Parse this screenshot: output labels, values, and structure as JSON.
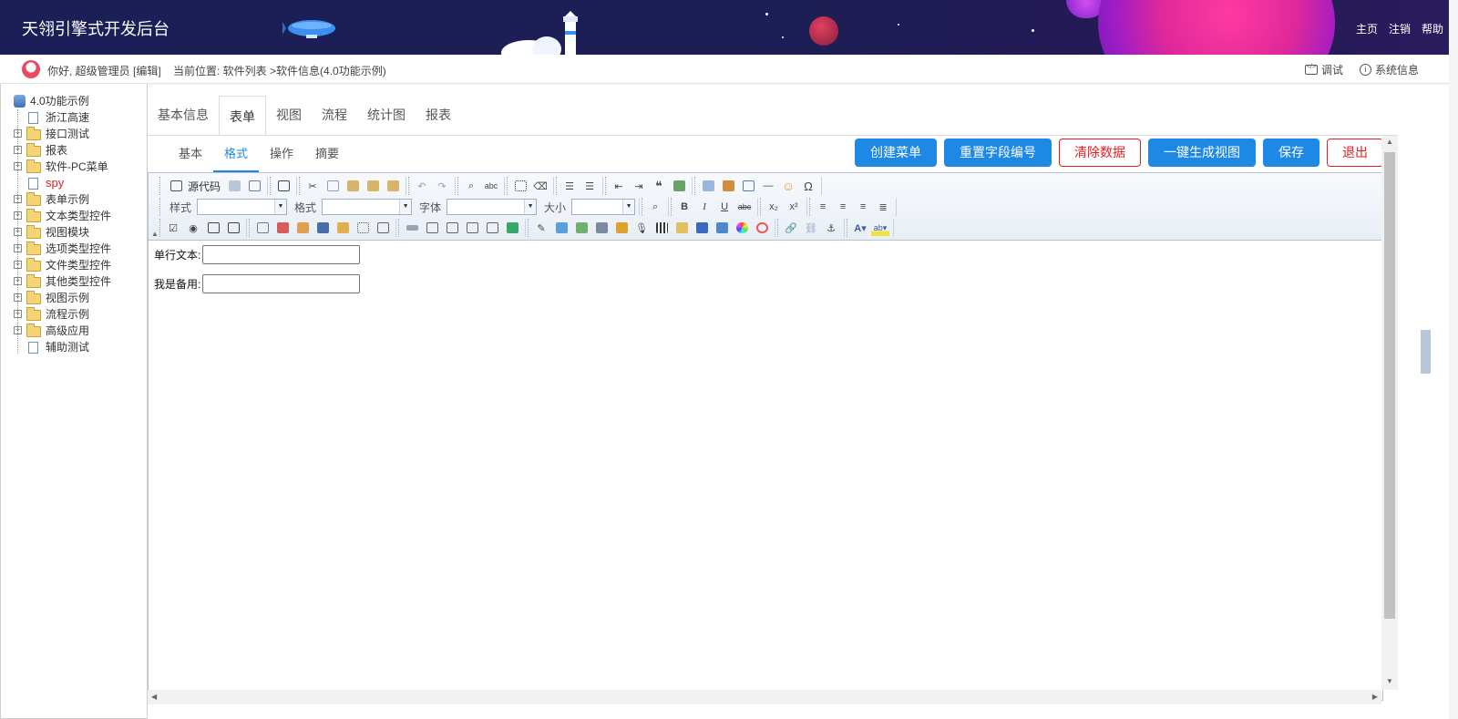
{
  "header": {
    "title": "天翎引擎式开发后台",
    "nav": [
      "主页",
      "注销",
      "帮助"
    ]
  },
  "infobar": {
    "greeting": "你好, 超级管理员 [编辑]",
    "location": "当前位置: 软件列表 >软件信息(4.0功能示例)",
    "debug": "调试",
    "sysinfo": "系统信息"
  },
  "tree": {
    "root": "4.0功能示例",
    "items": [
      {
        "label": "浙江高速",
        "type": "doc"
      },
      {
        "label": "接口测试",
        "type": "folder"
      },
      {
        "label": "报表",
        "type": "folder"
      },
      {
        "label": "软件-PC菜单",
        "type": "folder"
      },
      {
        "label": "spy",
        "type": "doc",
        "highlight": true
      },
      {
        "label": "表单示例",
        "type": "folder"
      },
      {
        "label": "文本类型控件",
        "type": "folder"
      },
      {
        "label": "视图模块",
        "type": "folder"
      },
      {
        "label": "选项类型控件",
        "type": "folder"
      },
      {
        "label": "文件类型控件",
        "type": "folder"
      },
      {
        "label": "其他类型控件",
        "type": "folder"
      },
      {
        "label": "视图示例",
        "type": "folder"
      },
      {
        "label": "流程示例",
        "type": "folder"
      },
      {
        "label": "高级应用",
        "type": "folder"
      },
      {
        "label": "辅助测试",
        "type": "doc"
      }
    ]
  },
  "tabs": [
    "基本信息",
    "表单",
    "视图",
    "流程",
    "统计图",
    "报表"
  ],
  "active_tab": "表单",
  "subtabs": [
    "基本",
    "格式",
    "操作",
    "摘要"
  ],
  "active_subtab": "格式",
  "buttons": {
    "create_menu": "创建菜单",
    "reset_field": "重置字段编号",
    "clear_data": "清除数据",
    "generate_view": "一键生成视图",
    "save": "保存",
    "exit": "退出"
  },
  "toolbar": {
    "source": "源代码",
    "style_label": "样式",
    "format_label": "格式",
    "font_label": "字体",
    "size_label": "大小"
  },
  "form": {
    "field1_label": "单行文本:",
    "field2_label": "我是备用:"
  },
  "colors": {
    "primary": "#1e88e5",
    "danger": "#e02020",
    "header_bg": "#1c1f57"
  }
}
